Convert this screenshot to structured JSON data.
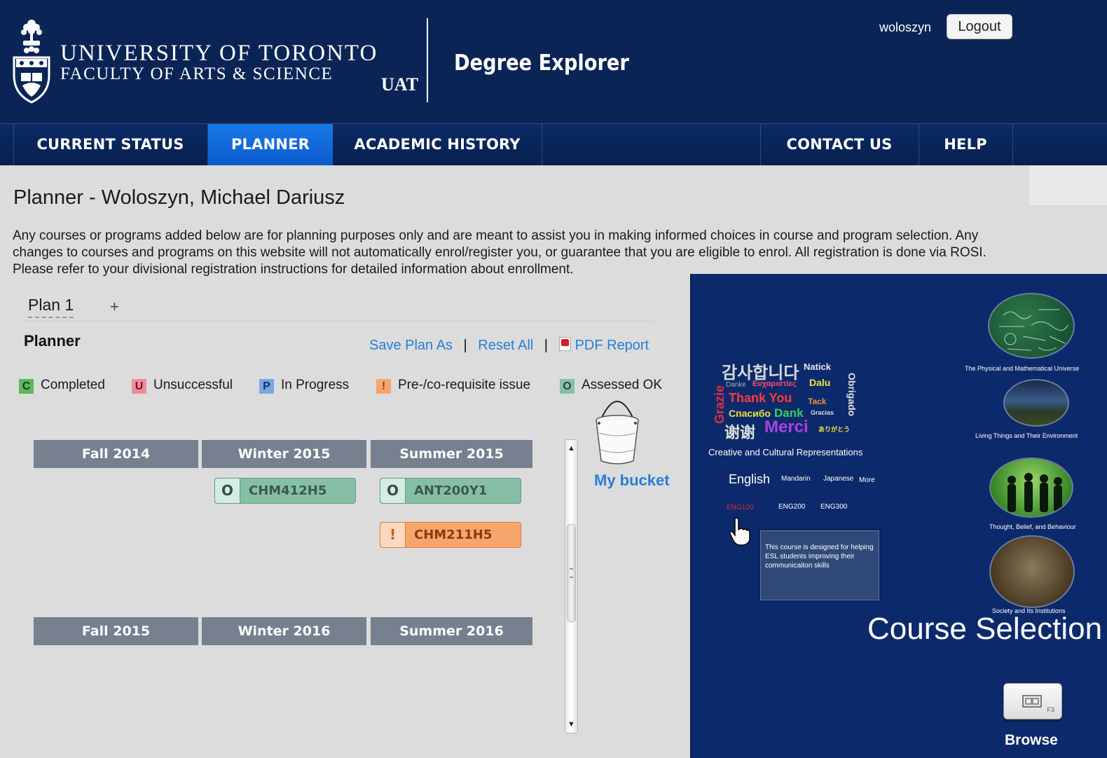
{
  "header": {
    "university_line1": "UNIVERSITY OF TORONTO",
    "university_line2": "FACULTY OF ARTS & SCIENCE",
    "env_label": "UAT",
    "app_title": "Degree Explorer",
    "username": "woloszyn",
    "logout_label": "Logout",
    "crest_icon": "university-crest-icon"
  },
  "nav": {
    "current_status": "CURRENT STATUS",
    "planner": "PLANNER",
    "academic_history": "ACADEMIC HISTORY",
    "contact_us": "CONTACT US",
    "help": "HELP",
    "active": "PLANNER"
  },
  "page": {
    "title": "Planner - Woloszyn, Michael Dariusz",
    "intro": "Any courses or programs added below are for planning purposes only and are meant to assist you in making informed choices in course and program selection. Any changes to courses and programs on this website will not automatically enrol/register you, or guarantee that you are eligible to enrol. All registration is done via ROSI. Please refer to your divisional registration instructions for detailed information about enrollment."
  },
  "plan_tabs": {
    "tab1": "Plan 1",
    "add": "+"
  },
  "planner": {
    "label": "Planner",
    "save_plan_as": "Save Plan As",
    "reset_all": "Reset All",
    "pdf_report": "PDF Report",
    "separator": "|"
  },
  "legend": [
    {
      "badge": "C",
      "label": "Completed",
      "color": "#5cb85c",
      "bg": "#5cb85c",
      "fg": "#1a3a1a"
    },
    {
      "badge": "U",
      "label": "Unsuccessful",
      "color": "#e06070",
      "bg": "#f08c9a",
      "fg": "#7a1020"
    },
    {
      "badge": "P",
      "label": "In Progress",
      "color": "#3a7cd8",
      "bg": "#7aa6e6",
      "fg": "#10306a"
    },
    {
      "badge": "!",
      "label": "Pre-/co-requisite issue",
      "color": "#f0904a",
      "bg": "#f6a66d",
      "fg": "#9a3a08"
    },
    {
      "badge": "O",
      "label": "Assessed OK",
      "color": "#4a9c7a",
      "bg": "#86bfa6",
      "fg": "#244a3a"
    }
  ],
  "terms_row1": [
    "Fall 2014",
    "Winter 2015",
    "Summer 2015"
  ],
  "terms_row2": [
    "Fall 2015",
    "Winter 2016",
    "Summer 2016"
  ],
  "courses": {
    "winter_2015": [
      {
        "status": "O",
        "code": "CHM412H5"
      }
    ],
    "summer_2015": [
      {
        "status": "O",
        "code": "ANT200Y1"
      },
      {
        "status": "!",
        "code": "CHM211H5"
      }
    ]
  },
  "bucket": {
    "label": "My bucket",
    "icon": "bucket-icon"
  },
  "course_selection": {
    "cloud_caption": "Creative and Cultural Representations",
    "cloud_words": [
      "감사합니다",
      "Natick",
      "Danke",
      "Ευχαριστίες",
      "Dalu",
      "Grazie",
      "Thank You",
      "Tack",
      "Obrigado",
      "Спасибо",
      "Dank",
      "Gracias",
      "谢谢",
      "Merci",
      "ありがとう"
    ],
    "languages": {
      "english": "English",
      "mandarin": "Mandarin",
      "japanese": "Japanese",
      "more": "More"
    },
    "levels": {
      "eng100": "ENG100",
      "eng200": "ENG200",
      "eng300": "ENG300"
    },
    "tooltip": "This course is designed for helping ESL students improving their communicaiton skills",
    "categories": {
      "physical": "The Physical and Mathematical Universe",
      "living": "Living Things and Their Environment",
      "thought": "Thought, Belief, and Behaviour",
      "society": "Society and Its Institutions"
    },
    "heading": "Course Selection",
    "browse_label": "Browse",
    "browse_key": "F3",
    "highlight_color": "#e0203a"
  }
}
